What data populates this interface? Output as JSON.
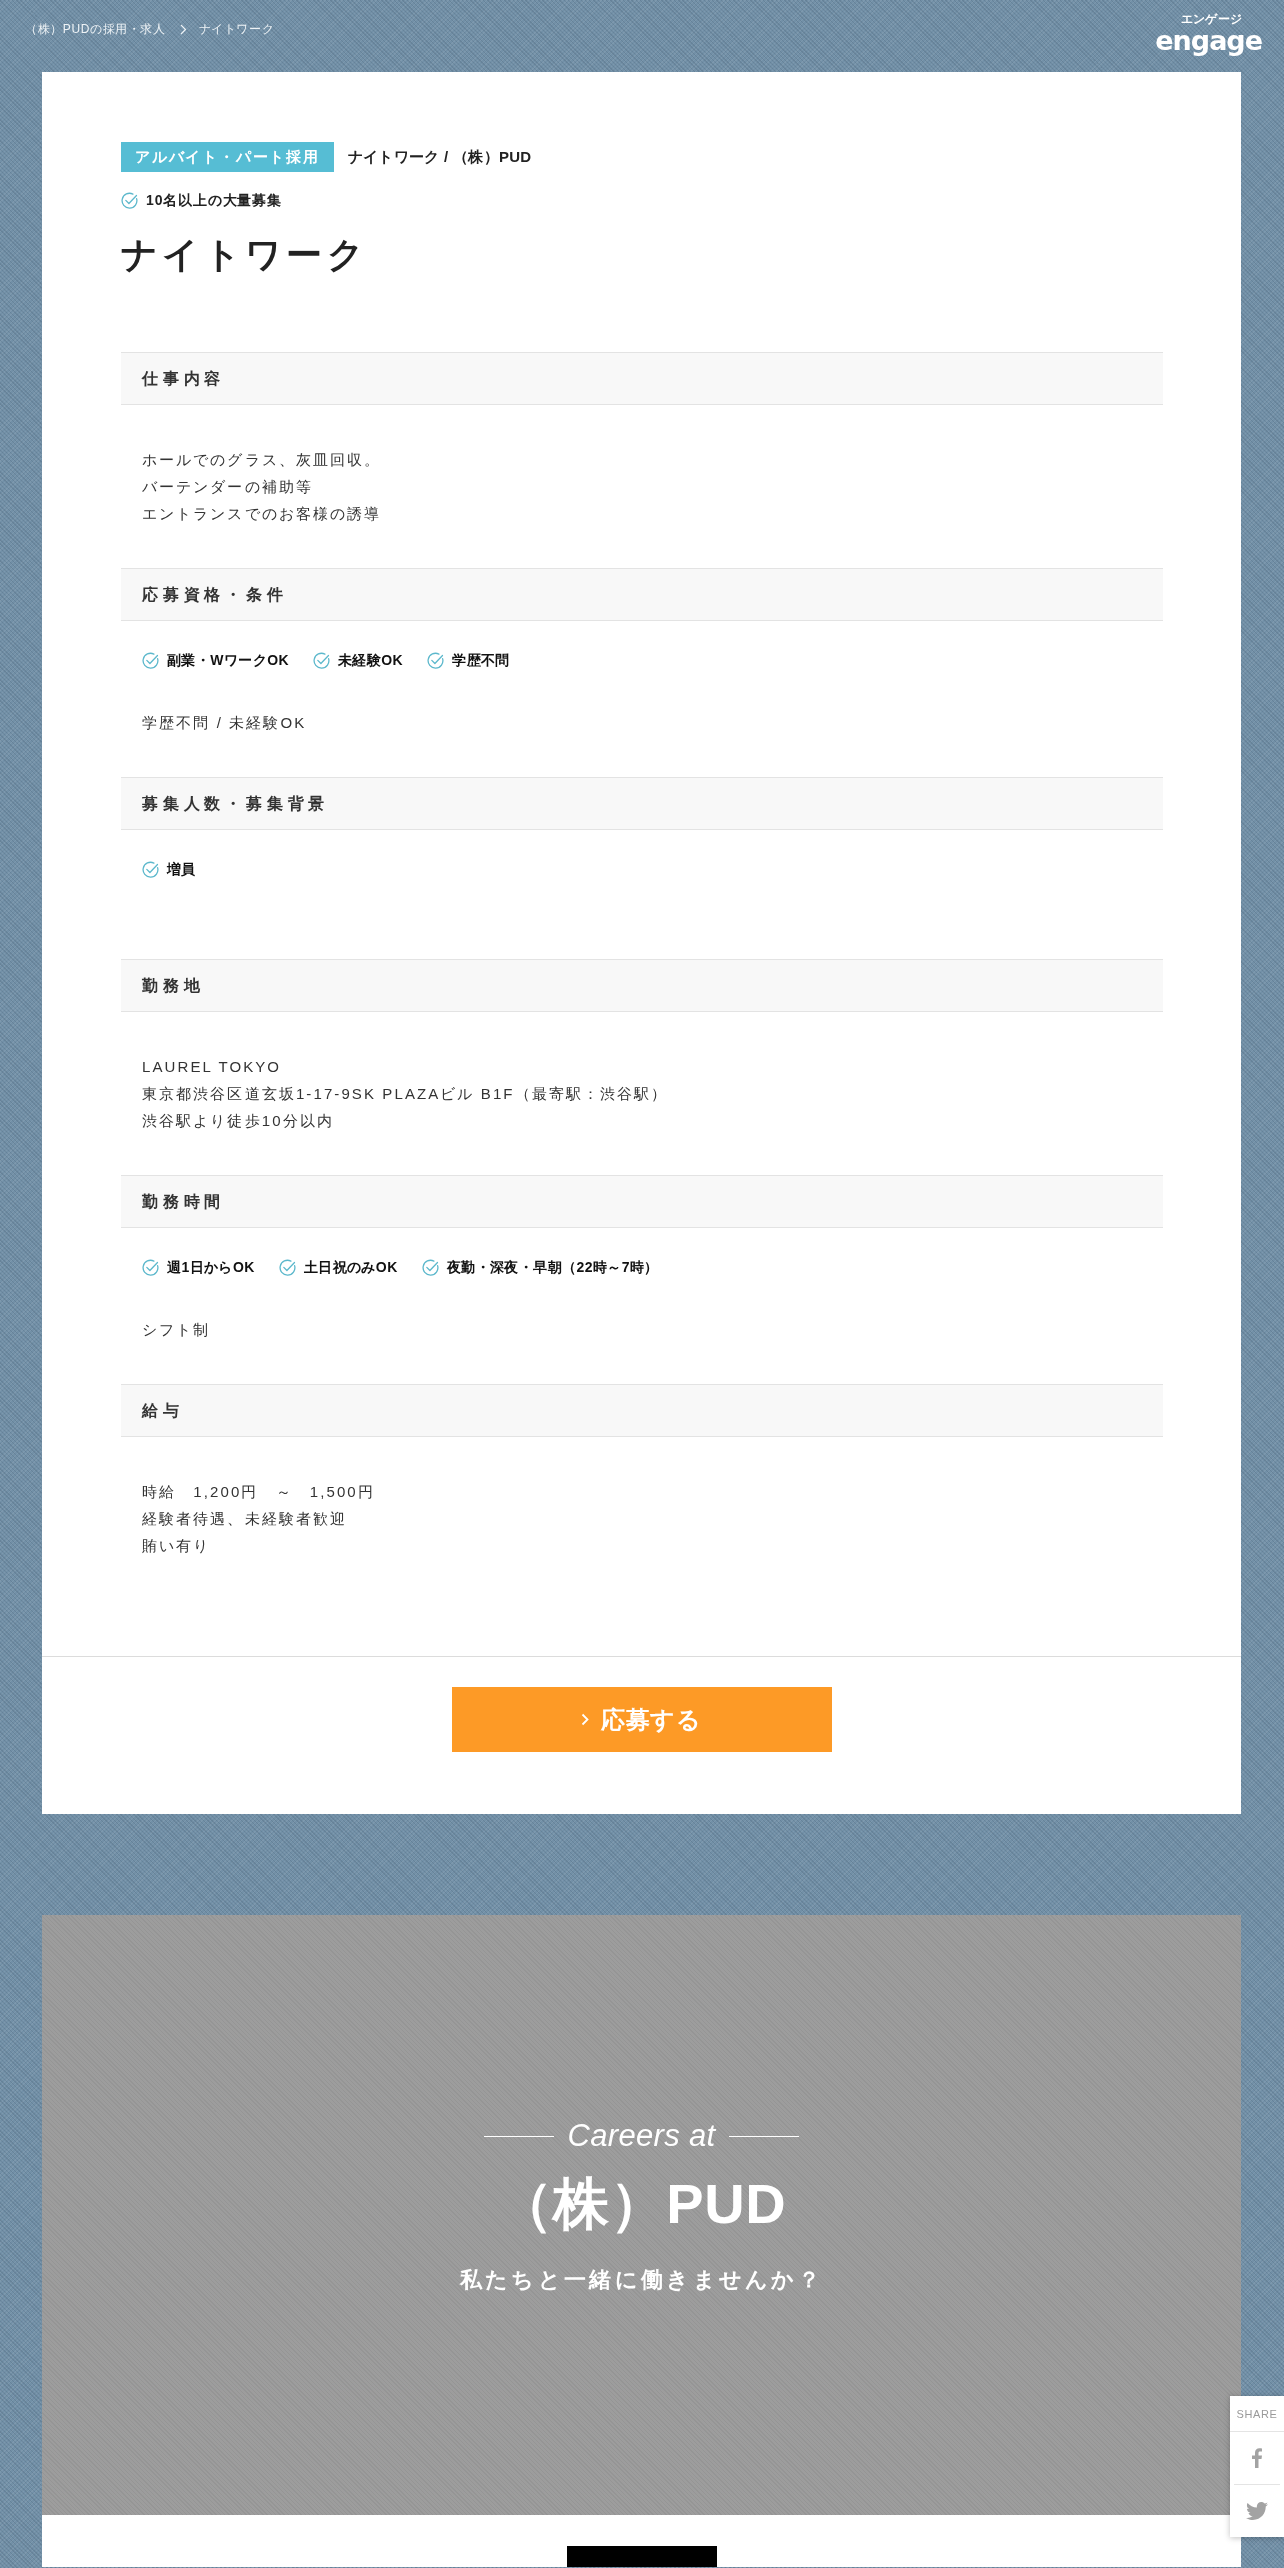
{
  "breadcrumb": [
    {
      "label": "（株）PUDの採用・求人"
    },
    {
      "label": "ナイトワーク"
    }
  ],
  "logo": {
    "kana": "エンゲージ",
    "wordmark": "engage"
  },
  "job": {
    "employment_tag": "アルバイト・パート採用",
    "subtitle": "ナイトワーク / （株）PUD",
    "highlights": [
      "10名以上の大量募集"
    ],
    "title": "ナイトワーク"
  },
  "sections": [
    {
      "heading": "仕事内容",
      "lines": [
        "ホールでのグラス、灰皿回収。",
        "バーテンダーの補助等",
        "エントランスでのお客様の誘導"
      ]
    },
    {
      "heading": "応募資格・条件",
      "features": [
        "副業・WワークOK",
        "未経験OK",
        "学歴不問"
      ],
      "lines": [
        "学歴不問 / 未経験OK"
      ]
    },
    {
      "heading": "募集人数・募集背景",
      "features": [
        "増員"
      ]
    },
    {
      "heading": "勤務地",
      "lines": [
        "LAUREL TOKYO",
        "東京都渋谷区道玄坂1-17-9SK PLAZAビル B1F（最寄駅：渋谷駅）",
        "渋谷駅より徒歩10分以内"
      ]
    },
    {
      "heading": "勤務時間",
      "features": [
        "週1日からOK",
        "土日祝のみOK",
        "夜勤・深夜・早朝（22時～7時）"
      ],
      "lines": [
        "シフト制"
      ]
    },
    {
      "heading": "給与",
      "lines": [
        "時給　1,200円　～　1,500円",
        "経験者待遇、未経験者歓迎",
        "賄い有り"
      ]
    }
  ],
  "apply_button": {
    "label": "応募する"
  },
  "careers": {
    "lead": "Careers at",
    "company": "（株）PUD",
    "tagline": "私たちと一緒に働きませんか？"
  },
  "share": {
    "label": "SHARE"
  }
}
